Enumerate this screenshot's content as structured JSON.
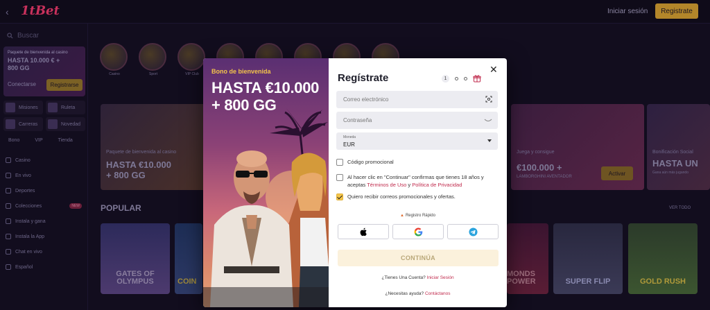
{
  "topbar": {
    "logo": "1tBet",
    "login": "Iniciar sesión",
    "register": "Registrate"
  },
  "sidebar": {
    "search": "Buscar",
    "promo": {
      "subtitle": "Paquete de bienvenida al casino",
      "title": "HASTA 10.000 € + 800 GG",
      "login": "Conectarse",
      "register": "Registrarse"
    },
    "quick": [
      "Misiones",
      "Ruleta",
      "Carreras",
      "Novedad"
    ],
    "tabs": [
      "Bono",
      "VIP",
      "Tienda"
    ],
    "nav": [
      {
        "label": "Casino",
        "badge": ""
      },
      {
        "label": "En vivo",
        "badge": ""
      },
      {
        "label": "Deportes",
        "badge": ""
      },
      {
        "label": "Colecciones",
        "badge": "NEW"
      },
      {
        "label": "Instala y gana",
        "badge": ""
      },
      {
        "label": "Instala la App",
        "badge": ""
      },
      {
        "label": "Chat en vivo",
        "badge": ""
      },
      {
        "label": "Español",
        "badge": ""
      }
    ]
  },
  "main": {
    "categories": [
      "Casino",
      "Sport",
      "VIP Club",
      "",
      "",
      "",
      "",
      ""
    ],
    "banners": [
      {
        "subtitle": "Paquete de bienvenida al casino",
        "title": "HASTA €10.000\n+ 800 GG",
        "button": ""
      },
      {
        "subtitle": "Juega y consigue",
        "title": "€100.000 +",
        "small": "LAMBORGHINI AVENTADOR",
        "button": "Activar"
      },
      {
        "subtitle": "Bonificación Social",
        "title": "HASTA UN",
        "small": "Gana aún más jugando",
        "button": ""
      }
    ],
    "popular": "POPULAR",
    "see_all": "VER TODO",
    "tiles": [
      "GATES OF OLYMPUS",
      "COIN",
      "MONDS POWER",
      "SUPER FLIP",
      "GOLD RUSH"
    ]
  },
  "modal": {
    "bonus_subtitle": "Bono de bienvenida",
    "bonus_title": "HASTA €10.000 + 800 GG",
    "title": "Regístrate",
    "steps": [
      "1"
    ],
    "email_placeholder": "Correo electrónico",
    "password_placeholder": "Contraseña",
    "currency_label": "Moneda",
    "currency_value": "EUR",
    "promo_code": "Código promocional",
    "terms_text_1": "Al hacer clic en \"Continuar\" confirmas que tienes 18 años y aceptas ",
    "terms_link": "Términos de Uso",
    "terms_and": " y ",
    "privacy_link": "Política de Privacidad",
    "promo_emails": "Quiero recibir correos promocionales y ofertas.",
    "quick_register": "Registro Rápido",
    "continue": "CONTINÚA",
    "have_account": "¿Tienes Una Cuenta?",
    "login_link": "Iniciar Sesión",
    "need_help": "¿Necesitas ayuda?",
    "contact_link": "Contáctanos",
    "colors": {
      "accent": "#f4c54a",
      "link": "#c02a4c",
      "continue_bg": "#fbf1dc"
    }
  }
}
